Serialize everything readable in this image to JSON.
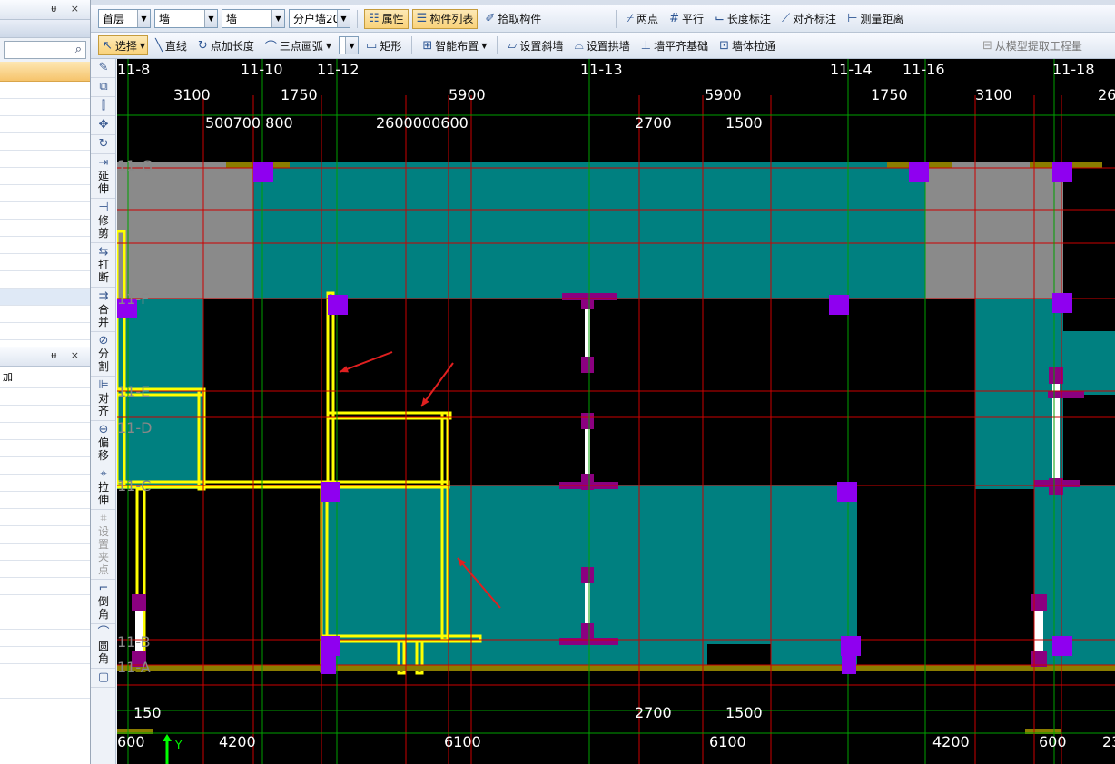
{
  "left_panel": {
    "top_buttons": "ᵾ ×",
    "bottom_buttons": "ᵾ ×",
    "bottom_col_label": "加"
  },
  "toolbar1": {
    "floor": "首层",
    "type": "墙",
    "subtype": "墙",
    "component": "分户墙20",
    "properties": "属性",
    "component_list": "构件列表",
    "pick": "拾取构件",
    "two_point": "两点",
    "parallel": "平行",
    "length_dim": "长度标注",
    "align_dim": "对齐标注",
    "measure": "测量距离"
  },
  "toolbar2": {
    "select": "选择",
    "line": "直线",
    "point_length": "点加长度",
    "arc3": "三点画弧",
    "rect": "矩形",
    "smart": "智能布置",
    "slope_wall": "设置斜墙",
    "arch_wall": "设置拱墙",
    "wall_footing": "墙平齐基础",
    "wall_extend": "墙体拉通",
    "extract": "从模型提取工程量"
  },
  "left_tools": [
    {
      "icon": "extend-icon",
      "label": "延伸",
      "glyph": "⇥"
    },
    {
      "icon": "trim-icon",
      "label": "修剪",
      "glyph": "⊣"
    },
    {
      "icon": "break-icon",
      "label": "打断",
      "glyph": "⇆"
    },
    {
      "icon": "merge-icon",
      "label": "合并",
      "glyph": "⇉"
    },
    {
      "icon": "split-icon",
      "label": "分割",
      "glyph": "⊘"
    },
    {
      "icon": "align-icon",
      "label": "对齐",
      "glyph": "⊫"
    },
    {
      "icon": "offset-icon",
      "label": "偏移",
      "glyph": "⊖"
    },
    {
      "icon": "stretch-icon",
      "label": "拉伸",
      "glyph": "⌖"
    },
    {
      "icon": "set-grip-icon",
      "label": "设置夹点",
      "glyph": "⌗"
    },
    {
      "icon": "chamfer-icon",
      "label": "倒角",
      "glyph": "⌐"
    },
    {
      "icon": "fillet-icon",
      "label": "圆角",
      "glyph": "⌒"
    }
  ],
  "drawing": {
    "axes_top": [
      "11-8",
      "11-10",
      "11-12",
      "11-13",
      "11-14",
      "11-16",
      "11-18"
    ],
    "axes_left": [
      "11-G",
      "11-F",
      "11-E",
      "11-D",
      "11-C",
      "11-B",
      "11-A"
    ],
    "dims_top_row1": [
      "3100",
      "1750",
      "5900",
      "5900",
      "1750",
      "3100",
      "26"
    ],
    "dims_top_row2": [
      "500700 800",
      "2600000600",
      "2700",
      "1500"
    ],
    "dims_bottom_row1": [
      "150",
      "2700",
      "1500"
    ],
    "dims_bottom_row2": [
      "600",
      "4200",
      "6100",
      "6100",
      "4200",
      "600",
      "23"
    ],
    "axis_y_label": "Y",
    "colors": {
      "teal": "#008080",
      "gray": "#8a8a8a",
      "grid_red": "#cc0000",
      "grid_green": "#00a000",
      "column": "#8f00f0",
      "wall_yellow": "#ffff00",
      "wall_purple": "#8b0080",
      "beam_olive": "#8b7d00"
    }
  }
}
